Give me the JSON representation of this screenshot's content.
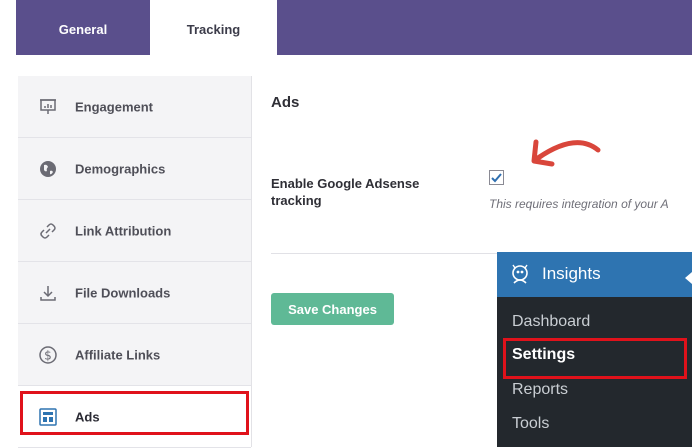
{
  "tabs": [
    {
      "label": "General",
      "active": false
    },
    {
      "label": "Tracking",
      "active": true
    }
  ],
  "sidebar": {
    "items": [
      {
        "label": "Engagement",
        "icon": "presentation-board-icon"
      },
      {
        "label": "Demographics",
        "icon": "globe-icon"
      },
      {
        "label": "Link Attribution",
        "icon": "link-icon"
      },
      {
        "label": "File Downloads",
        "icon": "download-icon"
      },
      {
        "label": "Affiliate Links",
        "icon": "dollar-circle-icon"
      },
      {
        "label": "Ads",
        "icon": "ad-layout-icon",
        "active": true
      }
    ]
  },
  "main": {
    "section_title": "Ads",
    "setting": {
      "label": "Enable Google Adsense tracking",
      "checked": true,
      "help_text": "This requires integration of your A"
    },
    "save_label": "Save Changes"
  },
  "wp_menu": {
    "title": "Insights",
    "items": [
      {
        "label": "Dashboard",
        "current": false
      },
      {
        "label": "Settings",
        "current": true
      },
      {
        "label": "Reports",
        "current": false
      },
      {
        "label": "Tools",
        "current": false
      }
    ]
  },
  "colors": {
    "tab_bar": "#5a4f8c",
    "save_button": "#5fb996",
    "wp_menu_bg": "#23282d",
    "wp_menu_header": "#2e74b1",
    "annotation_red": "#e0121b",
    "arrow_red": "#d9463b",
    "checkbox_check": "#2f6fb0"
  }
}
